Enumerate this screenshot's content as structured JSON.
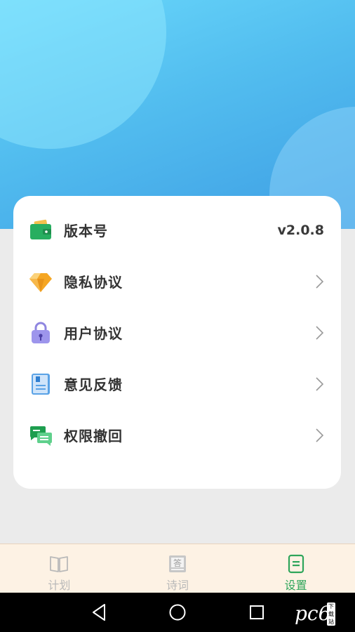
{
  "settings": {
    "items": [
      {
        "label": "版本号",
        "value": "v2.0.8",
        "icon": "wallet-icon"
      },
      {
        "label": "隐私协议",
        "icon": "diamond-icon"
      },
      {
        "label": "用户协议",
        "icon": "lock-icon"
      },
      {
        "label": "意见反馈",
        "icon": "notebook-icon"
      },
      {
        "label": "权限撤回",
        "icon": "chat-bubbles-icon"
      }
    ]
  },
  "tabbar": {
    "tabs": [
      {
        "label": "计划",
        "icon": "book-icon",
        "active": false
      },
      {
        "label": "诗词",
        "icon": "answer-card-icon",
        "active": false
      },
      {
        "label": "设置",
        "icon": "document-icon",
        "active": true
      }
    ]
  },
  "watermark": {
    "text": "pc6",
    "badge": "下载站"
  },
  "colors": {
    "accent": "#2ea55a",
    "hero_top": "#6ad8fb",
    "hero_bottom": "#3e9ee4",
    "tabbar_bg": "#fdf2e4"
  }
}
